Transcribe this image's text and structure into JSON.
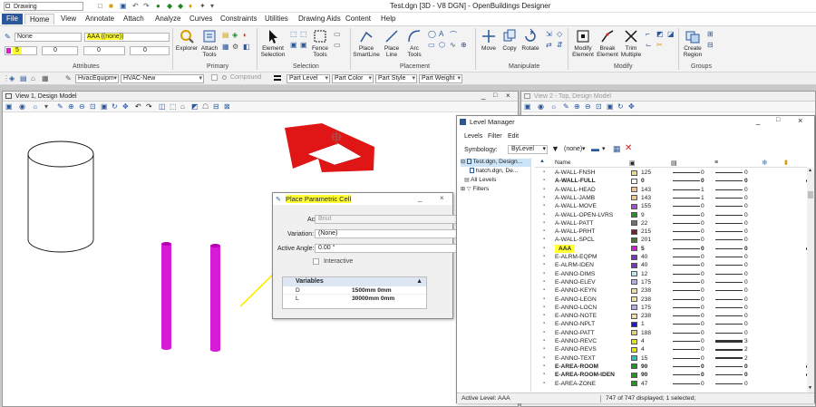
{
  "titlebar": {
    "workspace": "Drawing",
    "title": "Test.dgn [3D - V8 DGN] - OpenBuildings Designer"
  },
  "tabs": [
    "File",
    "Home",
    "View",
    "Annotate",
    "Attach",
    "Analyze",
    "Curves",
    "Constraints",
    "Utilities",
    "Drawing Aids",
    "Content",
    "Help"
  ],
  "attributes": {
    "level_combo_1": "None",
    "level_combo_2": "AAA ((none))",
    "color_value": "5",
    "weight_value": "0",
    "style_value": "0",
    "transparency_value": "0",
    "group_label": "Attributes"
  },
  "ribbon": {
    "primary": {
      "label": "Primary",
      "explorer": "Explorer",
      "attach_tools": "Attach Tools"
    },
    "selection": {
      "label": "Selection",
      "element_selection": "Element Selection",
      "fence_tools": "Fence Tools"
    },
    "placement": {
      "label": "Placement",
      "place_smartline": "Place SmartLine",
      "place_line": "Place Line",
      "arc_tools": "Arc Tools"
    },
    "manipulate": {
      "label": "Manipulate",
      "move": "Move",
      "copy": "Copy",
      "rotate": "Rotate"
    },
    "modify": {
      "label": "Modify",
      "modify_element": "Modify Element",
      "break_element": "Break Element",
      "trim_multiple": "Trim Multiple"
    },
    "groups": {
      "label": "Groups",
      "create_region": "Create Region"
    }
  },
  "attrbar": {
    "cell_category": "HvacEquipm",
    "cell_type": "HVAC-New",
    "compound": "Compound",
    "part_level": "Part Level",
    "part_color": "Part Color",
    "part_style": "Part Style",
    "part_weight": "Part Weight"
  },
  "view1": {
    "title": "View 1, Design Model"
  },
  "view2": {
    "title": "View 2 - Top, Design Model"
  },
  "place_dialog": {
    "title": "Place Parametric Cell",
    "active_cell_label": "Active Cell:",
    "active_cell_value": "Bnut",
    "variation_label": "Variation:",
    "variation_value": "(None)",
    "angle_label": "Active Angle:",
    "angle_value": "0.00 °",
    "interactive_label": "Interactive",
    "variables_header": "Variables",
    "variables": [
      {
        "name": "D",
        "value": "1500mm 0mm"
      },
      {
        "name": "L",
        "value": "30000mm 0mm"
      }
    ]
  },
  "level_manager": {
    "title": "Level Manager",
    "menu": [
      "Levels",
      "Filter",
      "Edit"
    ],
    "symbology_label": "Symbology:",
    "symbology_value": "ByLevel",
    "filter_value": "(none)",
    "tree": [
      "Test.dgn, Design...",
      "hatch.dgn, De...",
      "All Levels",
      "Filters"
    ],
    "header_name": "Name",
    "rows": [
      {
        "name": "A-WALL-FNSH",
        "color": "#f2d990",
        "num": "125",
        "v1": "0",
        "v2": "0",
        "bold": false
      },
      {
        "name": "A-WALL-FULL",
        "color": "#ffffff",
        "num": "0",
        "v1": "0",
        "v2": "0",
        "bold": true
      },
      {
        "name": "A-WALL-HEAD",
        "color": "#f2c590",
        "num": "143",
        "v1": "1",
        "v2": "0",
        "bold": false
      },
      {
        "name": "A-WALL-JAMB",
        "color": "#f2c590",
        "num": "143",
        "v1": "1",
        "v2": "0",
        "bold": false
      },
      {
        "name": "A-WALL-MOVE",
        "color": "#a64dd6",
        "num": "155",
        "v1": "0",
        "v2": "0",
        "bold": false
      },
      {
        "name": "A-WALL-OPEN-LVRS",
        "color": "#1e9a1e",
        "num": "9",
        "v1": "0",
        "v2": "0",
        "bold": false
      },
      {
        "name": "A-WALL-PATT",
        "color": "#707070",
        "num": "22",
        "v1": "0",
        "v2": "0",
        "bold": false
      },
      {
        "name": "A-WALL-PRHT",
        "color": "#7a2030",
        "num": "215",
        "v1": "0",
        "v2": "0",
        "bold": false
      },
      {
        "name": "A-WALL-SPCL",
        "color": "#4a7a30",
        "num": "201",
        "v1": "0",
        "v2": "0",
        "bold": false
      },
      {
        "name": "AAA",
        "color": "#d61ad6",
        "num": "5",
        "v1": "0",
        "v2": "0",
        "bold": true
      },
      {
        "name": "E-ALRM-EQPM",
        "color": "#7a35c0",
        "num": "40",
        "v1": "0",
        "v2": "0",
        "bold": false
      },
      {
        "name": "E-ALRM-IDEN",
        "color": "#7a35c0",
        "num": "40",
        "v1": "0",
        "v2": "0",
        "bold": false
      },
      {
        "name": "E-ANNO-DIMS",
        "color": "#bfe8e8",
        "num": "12",
        "v1": "0",
        "v2": "0",
        "bold": false
      },
      {
        "name": "E-ANNO-ELEV",
        "color": "#b0b0f0",
        "num": "175",
        "v1": "0",
        "v2": "0",
        "bold": false
      },
      {
        "name": "E-ANNO-KEYN",
        "color": "#f2e0a0",
        "num": "238",
        "v1": "0",
        "v2": "0",
        "bold": false
      },
      {
        "name": "E-ANNO-LEGN",
        "color": "#f2e0a0",
        "num": "238",
        "v1": "0",
        "v2": "0",
        "bold": false
      },
      {
        "name": "E-ANNO-LOCN",
        "color": "#b0b0f0",
        "num": "175",
        "v1": "0",
        "v2": "0",
        "bold": false
      },
      {
        "name": "E-ANNO-NOTE",
        "color": "#f2e0a0",
        "num": "238",
        "v1": "0",
        "v2": "0",
        "bold": false
      },
      {
        "name": "E-ANNO-NPLT",
        "color": "#1a1ad6",
        "num": "1",
        "v1": "0",
        "v2": "0",
        "bold": false
      },
      {
        "name": "E-ANNO-PATT",
        "color": "#e8d080",
        "num": "188",
        "v1": "0",
        "v2": "0",
        "bold": false
      },
      {
        "name": "E-ANNO-REVC",
        "color": "#e6e600",
        "num": "4",
        "v1": "0",
        "v2": "3",
        "bold": false
      },
      {
        "name": "E-ANNO-REVS",
        "color": "#e6e600",
        "num": "4",
        "v1": "0",
        "v2": "2",
        "bold": false
      },
      {
        "name": "E-ANNO-TEXT",
        "color": "#30c0c0",
        "num": "15",
        "v1": "0",
        "v2": "2",
        "bold": false
      },
      {
        "name": "E-AREA-ROOM",
        "color": "#1e9a1e",
        "num": "90",
        "v1": "0",
        "v2": "0",
        "bold": true
      },
      {
        "name": "E-AREA-ROOM-IDEN",
        "color": "#1e9a1e",
        "num": "90",
        "v1": "0",
        "v2": "0",
        "bold": true
      },
      {
        "name": "E-AREA-ZONE",
        "color": "#1e9a1e",
        "num": "47",
        "v1": "0",
        "v2": "0",
        "bold": false
      }
    ],
    "status_active": "Active Level: AAA",
    "status_count": "747 of 747 displayed; 1 selected;"
  }
}
